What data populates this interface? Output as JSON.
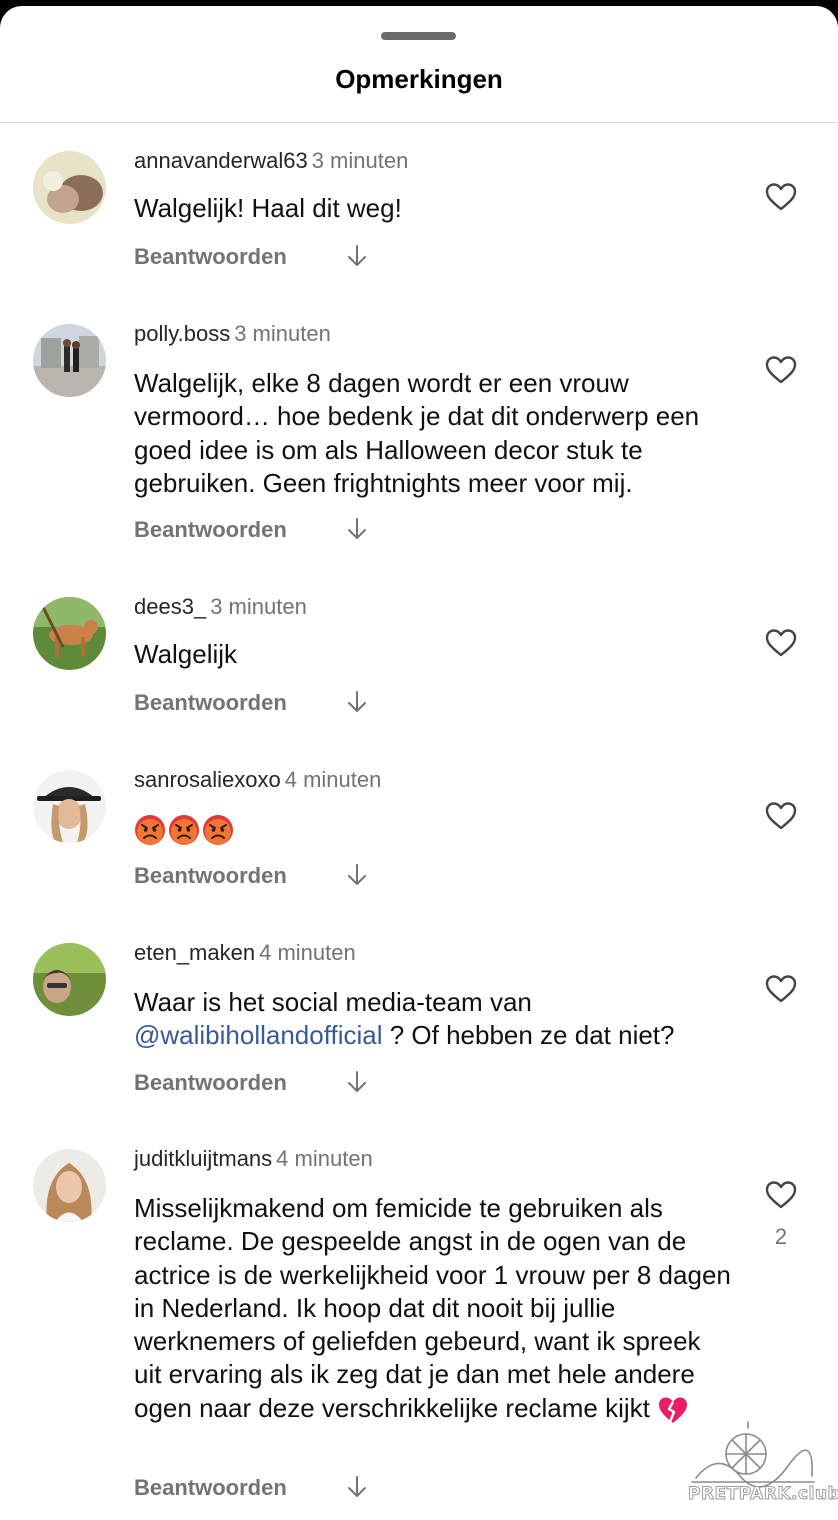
{
  "sheet": {
    "title": "Opmerkingen"
  },
  "comments": [
    {
      "user": "annavanderwal63",
      "time": "3 minuten",
      "text": "Walgelijk! Haal dit weg!",
      "reply_label": "Beantwoorden"
    },
    {
      "user": "polly.boss",
      "time": "3 minuten",
      "text": "Walgelijk, elke 8 dagen wordt er een vrouw vermoord… hoe bedenk je dat dit onderwerp een goed idee is om als Halloween decor stuk te gebruiken. Geen frightnights meer voor mij.",
      "reply_label": "Beantwoorden"
    },
    {
      "user": "dees3_",
      "time": "3 minuten",
      "text": "Walgelijk",
      "reply_label": "Beantwoorden"
    },
    {
      "user": "sanrosaliexoxo",
      "time": "4 minuten",
      "emoji": [
        "angry-face",
        "angry-face",
        "angry-face"
      ],
      "reply_label": "Beantwoorden"
    },
    {
      "user": "eten_maken",
      "time": "4 minuten",
      "text_before": "Waar is het social media-team van",
      "mention": "@walibihollandofficial",
      "text_after": " ? Of hebben ze dat niet?",
      "reply_label": "Beantwoorden"
    },
    {
      "user": "juditkluijtmans",
      "time": "4 minuten",
      "text": "Misselijkmakend om femicide te gebruiken als reclame. De gespeelde angst in de ogen van de actrice is de werkelijkheid voor 1 vrouw per 8 dagen in Nederland. Ik hoop dat dit nooit bij jullie werknemers of geliefden gebeurd, want ik spreek uit ervaring als ik zeg dat je dan met hele andere ogen naar deze verschrikkelijke reclame kijkt",
      "text_emoji": "broken-heart",
      "likes": "2",
      "reply_label": "Beantwoorden"
    }
  ],
  "watermark": "PRETPARK.club",
  "colors": {
    "mention": "#385898",
    "secondary_text": "#737373",
    "emoji_angry": "#e53935",
    "broken_heart": "#e91e63"
  }
}
